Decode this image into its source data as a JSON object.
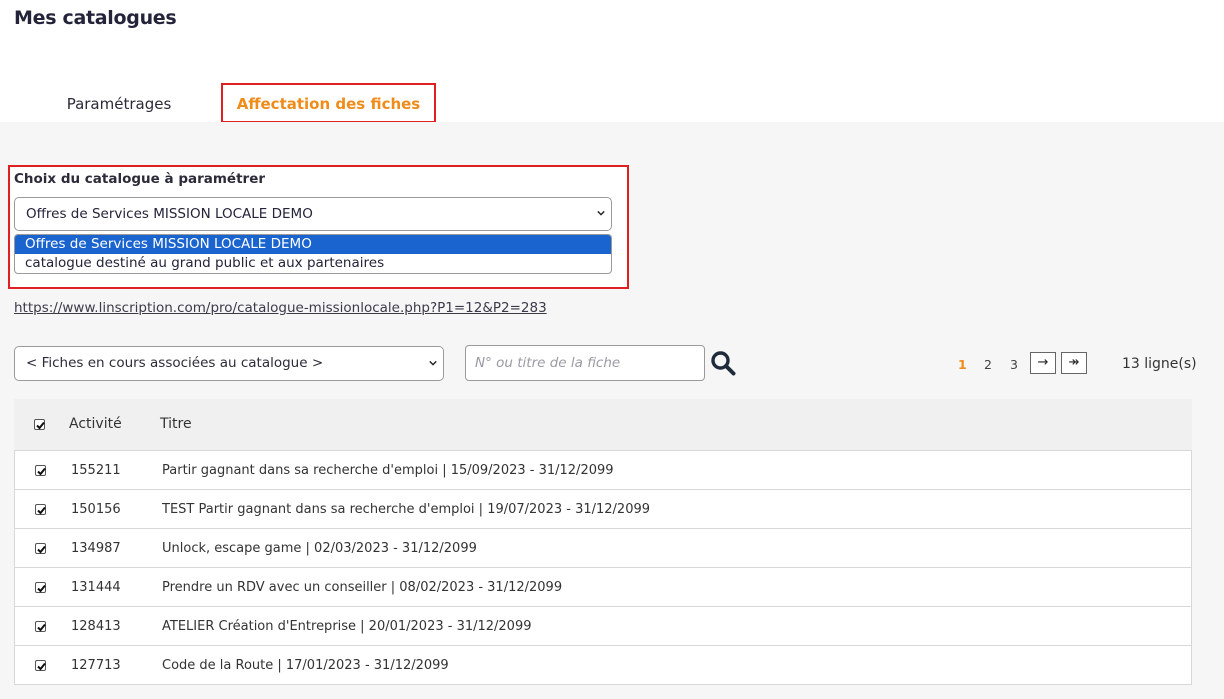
{
  "page": {
    "title": "Mes catalogues"
  },
  "tabs": [
    {
      "label": "Paramétrages",
      "active": false
    },
    {
      "label": "Affectation des fiches",
      "active": true
    }
  ],
  "catalog": {
    "label": "Choix du catalogue à paramétrer",
    "selected": "Offres de Services MISSION LOCALE DEMO",
    "options": [
      "Offres de Services MISSION LOCALE DEMO",
      "catalogue destiné au grand public et aux partenaires"
    ],
    "url": "https://www.linscription.com/pro/catalogue-missionlocale.php?P1=12&P2=283"
  },
  "filter": {
    "selected": "< Fiches en cours associées au catalogue >",
    "search_placeholder": "N° ou titre de la fiche"
  },
  "pagination": {
    "pages": [
      "1",
      "2",
      "3"
    ],
    "current": "1",
    "next_label": "→",
    "last_label": "↠",
    "count_label": "13 ligne(s)"
  },
  "table": {
    "headers": {
      "activity": "Activité",
      "title": "Titre"
    },
    "rows": [
      {
        "id": "155211",
        "title": "Partir gagnant dans sa recherche d'emploi | 15/09/2023 - 31/12/2099"
      },
      {
        "id": "150156",
        "title": "TEST Partir gagnant dans sa recherche d'emploi | 19/07/2023 - 31/12/2099"
      },
      {
        "id": "134987",
        "title": "Unlock, escape game | 02/03/2023 - 31/12/2099"
      },
      {
        "id": "131444",
        "title": "Prendre un RDV avec un conseiller | 08/02/2023 - 31/12/2099"
      },
      {
        "id": "128413",
        "title": "ATELIER Création d'Entreprise | 20/01/2023 - 31/12/2099"
      },
      {
        "id": "127713",
        "title": "Code de la Route | 17/01/2023 - 31/12/2099"
      }
    ]
  },
  "colors": {
    "accent": "#f08c1a",
    "highlight_border": "#e02020",
    "selection_blue": "#1a64cf"
  }
}
